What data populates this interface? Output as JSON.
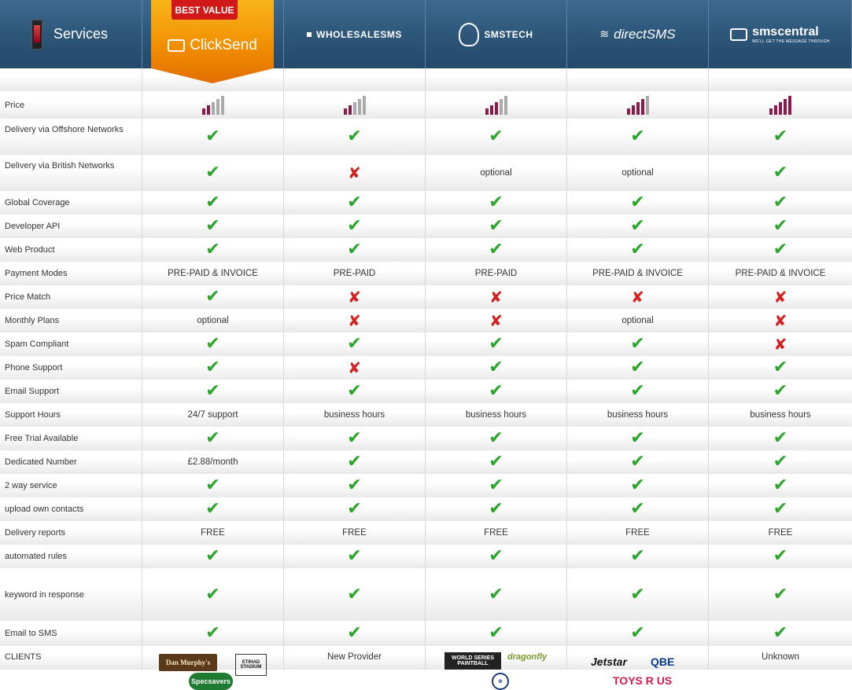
{
  "header": {
    "services_label": "Services",
    "best_value": "BEST VALUE",
    "providers": [
      {
        "name": "ClickSend",
        "logo_icon": "speech-bubble-icon"
      },
      {
        "name": "WHOLESALESMS",
        "logo_icon": "square-icon"
      },
      {
        "name": "SMSTECH",
        "logo_icon": "smstech-shield-icon"
      },
      {
        "name": "directSMS",
        "logo_icon": "wings-icon"
      },
      {
        "name": "smscentral",
        "tagline": "WE'LL GET THE MESSAGE THROUGH",
        "logo_icon": "speech-bubble-icon"
      }
    ]
  },
  "colors": {
    "header": "#2c5577",
    "ribbon": "#f08c00",
    "best_value": "#d01818",
    "check": "#2aa52a",
    "cross": "#d62020",
    "bar_on": "#8a1a4a",
    "bar_off": "#aaaaaa"
  },
  "price_levels": [
    2,
    2,
    3,
    4,
    5
  ],
  "rows": [
    {
      "label": "Price",
      "values": [
        "bars",
        "bars",
        "bars",
        "bars",
        "bars"
      ]
    },
    {
      "label": "Delivery via Offshore Networks",
      "values": [
        "check",
        "check",
        "check",
        "check",
        "check"
      ]
    },
    {
      "label": "Delivery via British Networks",
      "values": [
        "check",
        "cross",
        "optional",
        "optional",
        "check"
      ]
    },
    {
      "label": "Global Coverage",
      "values": [
        "check",
        "check",
        "check",
        "check",
        "check"
      ]
    },
    {
      "label": "Developer API",
      "values": [
        "check",
        "check",
        "check",
        "check",
        "check"
      ]
    },
    {
      "label": "Web Product",
      "values": [
        "check",
        "check",
        "check",
        "check",
        "check"
      ]
    },
    {
      "label": "Payment Modes",
      "values": [
        "PRE-PAID & INVOICE",
        "PRE-PAID",
        "PRE-PAID",
        "PRE-PAID & INVOICE",
        "PRE-PAID & INVOICE"
      ]
    },
    {
      "label": "Price Match",
      "values": [
        "check",
        "cross",
        "cross",
        "cross",
        "cross"
      ]
    },
    {
      "label": "Monthly Plans",
      "values": [
        "optional",
        "cross",
        "cross",
        "optional",
        "cross"
      ]
    },
    {
      "label": "Spam Compliant",
      "values": [
        "check",
        "check",
        "check",
        "check",
        "cross"
      ]
    },
    {
      "label": "Phone Support",
      "values": [
        "check",
        "cross",
        "check",
        "check",
        "check"
      ]
    },
    {
      "label": "Email Support",
      "values": [
        "check",
        "check",
        "check",
        "check",
        "check"
      ]
    },
    {
      "label": "Support Hours",
      "values": [
        "24/7 support",
        "business hours",
        "business hours",
        "business hours",
        "business hours"
      ]
    },
    {
      "label": "Free Trial Available",
      "values": [
        "check",
        "check",
        "check",
        "check",
        "check"
      ]
    },
    {
      "label": "Dedicated Number",
      "values": [
        "£2.88/month",
        "check",
        "check",
        "check",
        "check"
      ]
    },
    {
      "label": "2 way service",
      "values": [
        "check",
        "check",
        "check",
        "check",
        "check"
      ]
    },
    {
      "label": "upload own contacts",
      "values": [
        "check",
        "check",
        "check",
        "check",
        "check"
      ]
    },
    {
      "label": "Delivery reports",
      "values": [
        "FREE",
        "FREE",
        "FREE",
        "FREE",
        "FREE"
      ]
    },
    {
      "label": "automated rules",
      "values": [
        "check",
        "check",
        "check",
        "check",
        "check"
      ]
    },
    {
      "label": "keyword in response",
      "values": [
        "check",
        "check",
        "check",
        "check",
        "check"
      ]
    },
    {
      "label": "Email to SMS",
      "values": [
        "check",
        "check",
        "check",
        "check",
        "check"
      ]
    }
  ],
  "clients": {
    "label": "CLIENTS",
    "clicksend": {
      "dan_murphys": "Dan Murphy's",
      "etihad": "ETIHAD",
      "etihad_sub": "STADIUM",
      "specsavers": "Specsavers"
    },
    "wholesalesms": "New Provider",
    "smstech": {
      "wsp": "WORLD SERIES PAINTBALL",
      "dragonfly": "dragonfly"
    },
    "directsms": {
      "jetstar": "Jetstar",
      "qbe": "QBE",
      "toysrus": "TOYS R US"
    },
    "smscentral": "Unknown"
  }
}
